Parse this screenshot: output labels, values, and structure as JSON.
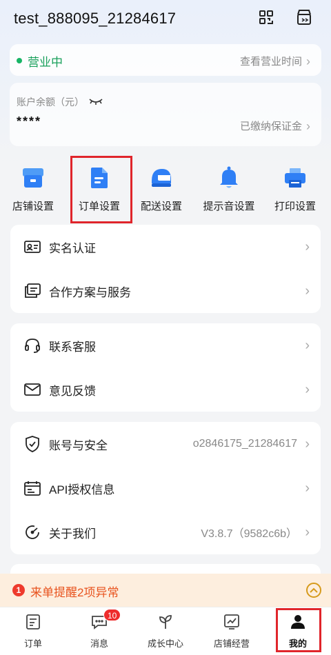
{
  "header": {
    "account_name": "test_888095_21284617",
    "icons": [
      "qr-code-icon",
      "store-icon"
    ]
  },
  "status": {
    "text": "营业中",
    "link": "查看营业时间",
    "dot_color": "#18b566"
  },
  "balance": {
    "label": "账户余额（元）",
    "value": "****",
    "deposit_link": "已缴纳保证金"
  },
  "shortcuts": [
    {
      "label": "店铺设置",
      "icon": "store-settings-icon"
    },
    {
      "label": "订单设置",
      "icon": "order-settings-icon"
    },
    {
      "label": "配送设置",
      "icon": "delivery-helmet-icon"
    },
    {
      "label": "提示音设置",
      "icon": "bell-icon"
    },
    {
      "label": "打印设置",
      "icon": "printer-icon"
    }
  ],
  "group1": [
    {
      "label": "实名认证",
      "icon": "id-card-icon",
      "value": ""
    },
    {
      "label": "合作方案与服务",
      "icon": "documents-icon",
      "value": ""
    }
  ],
  "group2": [
    {
      "label": "联系客服",
      "icon": "headset-icon",
      "value": ""
    },
    {
      "label": "意见反馈",
      "icon": "mail-icon",
      "value": ""
    }
  ],
  "group3": [
    {
      "label": "账号与安全",
      "icon": "shield-icon",
      "value": "o2846175_21284617"
    },
    {
      "label": "API授权信息",
      "icon": "api-calendar-icon",
      "value": ""
    },
    {
      "label": "关于我们",
      "icon": "about-gauge-icon",
      "value": "V3.8.7（9582c6b）"
    }
  ],
  "alert": {
    "count": "1",
    "text": "来单提醒2项异常"
  },
  "tabbar": [
    {
      "label": "订单",
      "icon": "order-tab-icon"
    },
    {
      "label": "消息",
      "icon": "message-tab-icon",
      "badge": "10"
    },
    {
      "label": "成长中心",
      "icon": "sprout-icon"
    },
    {
      "label": "店铺经营",
      "icon": "chart-board-icon"
    },
    {
      "label": "我的",
      "icon": "user-icon"
    }
  ],
  "colors": {
    "accent_green": "#18a05a",
    "highlight_red": "#e0252b",
    "alert_orange": "#e8531e",
    "shortcut_blue": "#2f7ff5"
  }
}
